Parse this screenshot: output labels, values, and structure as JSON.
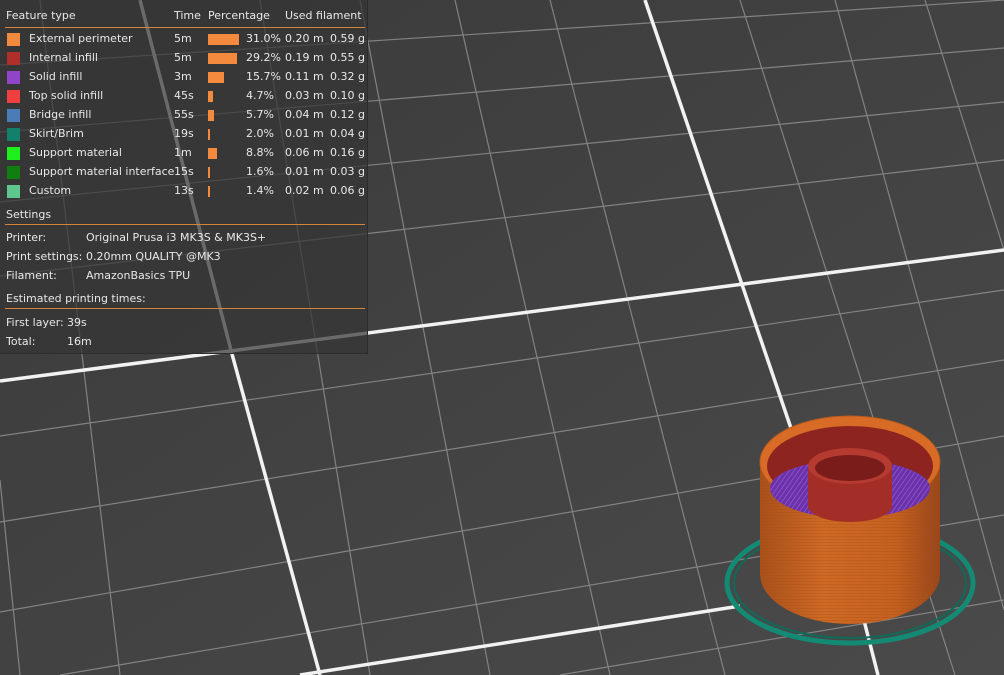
{
  "legend": {
    "headers": {
      "feature": "Feature type",
      "time": "Time",
      "percentage": "Percentage",
      "filament": "Used filament"
    },
    "rows": [
      {
        "label": "External perimeter",
        "color": "#f28a3d",
        "time": "5m",
        "fraction": 0.31,
        "pct": "31.0%",
        "length": "0.20 m",
        "weight": "0.59 g"
      },
      {
        "label": "Internal infill",
        "color": "#b02f2a",
        "time": "5m",
        "fraction": 0.292,
        "pct": "29.2%",
        "length": "0.19 m",
        "weight": "0.55 g"
      },
      {
        "label": "Solid infill",
        "color": "#9045c8",
        "time": "3m",
        "fraction": 0.157,
        "pct": "15.7%",
        "length": "0.11 m",
        "weight": "0.32 g"
      },
      {
        "label": "Top solid infill",
        "color": "#ef3f3f",
        "time": "45s",
        "fraction": 0.047,
        "pct": "4.7%",
        "length": "0.03 m",
        "weight": "0.10 g"
      },
      {
        "label": "Bridge infill",
        "color": "#4c7cb8",
        "time": "55s",
        "fraction": 0.057,
        "pct": "5.7%",
        "length": "0.04 m",
        "weight": "0.12 g"
      },
      {
        "label": "Skirt/Brim",
        "color": "#13806c",
        "time": "19s",
        "fraction": 0.02,
        "pct": "2.0%",
        "length": "0.01 m",
        "weight": "0.04 g"
      },
      {
        "label": "Support material",
        "color": "#1ef01e",
        "time": "1m",
        "fraction": 0.088,
        "pct": "8.8%",
        "length": "0.06 m",
        "weight": "0.16 g"
      },
      {
        "label": "Support material interface",
        "color": "#107f10",
        "time": "15s",
        "fraction": 0.016,
        "pct": "1.6%",
        "length": "0.01 m",
        "weight": "0.03 g"
      },
      {
        "label": "Custom",
        "color": "#5ec78e",
        "time": "13s",
        "fraction": 0.014,
        "pct": "1.4%",
        "length": "0.02 m",
        "weight": "0.06 g"
      }
    ],
    "settings_title": "Settings",
    "settings": [
      {
        "key": "Printer:",
        "value": "Original Prusa i3 MK3S & MK3S+"
      },
      {
        "key": "Print settings:",
        "value": "0.20mm QUALITY @MK3"
      },
      {
        "key": "Filament:",
        "value": "AmazonBasics TPU"
      }
    ],
    "times_title": "Estimated printing times:",
    "times": [
      {
        "key": "First layer:",
        "value": "39s"
      },
      {
        "key": "Total:",
        "value": "16m"
      }
    ]
  },
  "colors": {
    "accent": "#d8823a",
    "bed": "#3c3c3c",
    "grid_line": "#8a8a8a",
    "grid_major": "#f0f0f0"
  }
}
